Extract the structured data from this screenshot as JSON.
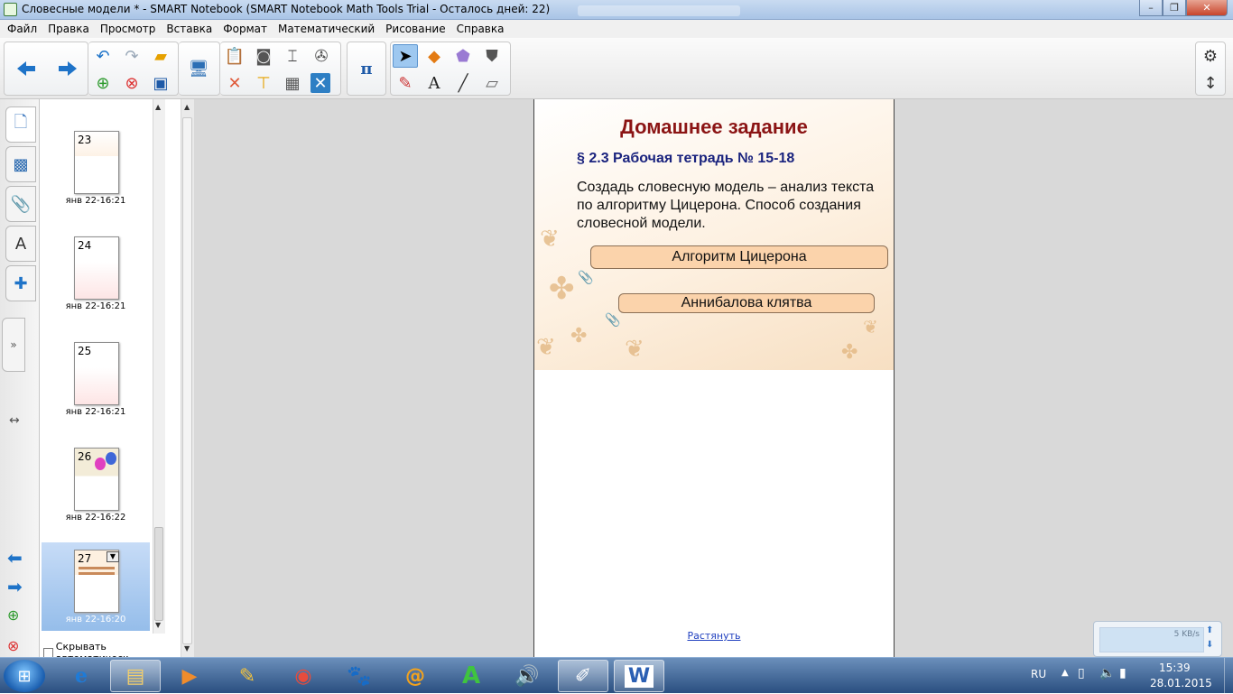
{
  "window": {
    "title": "Словесные модели * - SMART Notebook (SMART Notebook Math Tools Trial - Осталось дней: 22)",
    "min_glyph": "–",
    "max_glyph": "❐",
    "close_glyph": "✕"
  },
  "menu": [
    "Файл",
    "Правка",
    "Просмотр",
    "Вставка",
    "Формат",
    "Математический",
    "Рисование",
    "Справка"
  ],
  "toolbar": {
    "back_icon": "arrow-left-icon",
    "forward_icon": "arrow-right-icon",
    "pi_label": "π"
  },
  "sidebar": {
    "tabs": [
      "page-sorter-icon",
      "gallery-icon",
      "attachments-icon",
      "properties-icon",
      "addons-icon"
    ],
    "auto_hide_label": "Скрывать автоматическ",
    "pages": [
      {
        "num": "23",
        "date": "янв 22-16:21"
      },
      {
        "num": "24",
        "date": "янв 22-16:21"
      },
      {
        "num": "25",
        "date": "янв 22-16:21"
      },
      {
        "num": "26",
        "date": "янв 22-16:22"
      },
      {
        "num": "27",
        "date": "янв 22-16:20"
      }
    ]
  },
  "slide": {
    "title": "Домашнее задание",
    "subtitle": "§ 2.3  Рабочая тетрадь № 15-18",
    "body": "Создадь словесную модель – анализ текста по алгоритму Цицерона. Способ создания словесной модели.",
    "button1": "Алгоритм Цицерона",
    "button2": "Аннибалова клятва",
    "stretch_link": "Растянуть"
  },
  "netmon": {
    "speed": "5 KB/s"
  },
  "tray": {
    "lang": "RU",
    "time": "15:39",
    "date": "28.01.2015"
  },
  "colors": {
    "title_red": "#8b1414",
    "subtitle_blue": "#1a237e",
    "pill_fill": "#fbd3ab"
  }
}
